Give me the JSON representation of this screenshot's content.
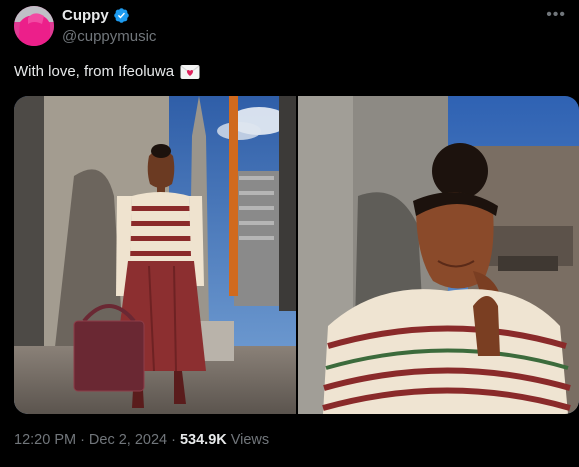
{
  "author": {
    "display_name": "Cuppy",
    "handle": "@cuppymusic",
    "verified": true,
    "avatar_color": "#d92d8c"
  },
  "more_icon": "more-horizontal-icon",
  "tweet": {
    "text": "With love, from Ifeoluwa",
    "emoji": "love-letter-emoji"
  },
  "meta": {
    "time": "12:20 PM",
    "separator1": "·",
    "date": "Dec 2, 2024",
    "separator2": "·",
    "views_count": "534.9K",
    "views_label": "Views"
  },
  "colors": {
    "background": "#000000",
    "primary_text": "#e7e9ea",
    "secondary_text": "#71767b",
    "verified_blue": "#1d9bf0"
  }
}
